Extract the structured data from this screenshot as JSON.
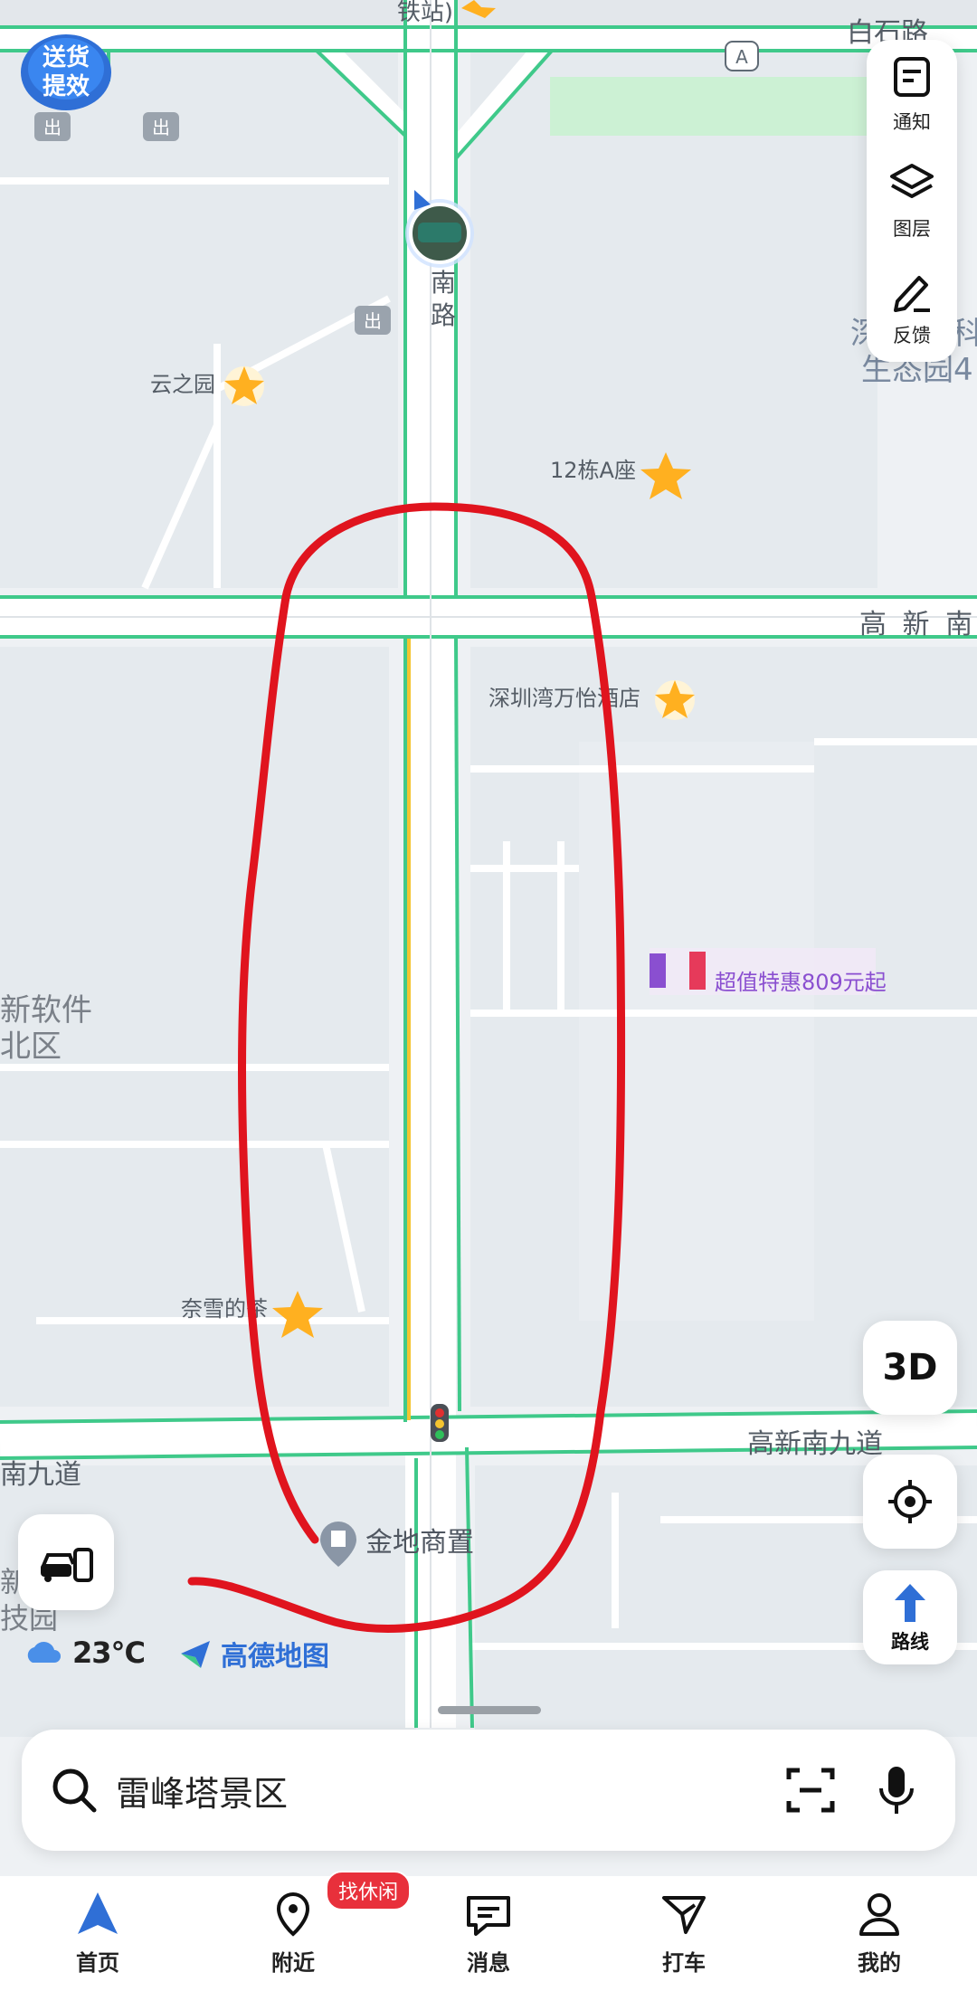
{
  "map": {
    "labels": {
      "station_top": "铁站)",
      "corner_top_right": "白石路",
      "exit_a": "A",
      "exit_1": "出",
      "exit_2": "出",
      "exit_3": "出",
      "road_vertical_1": "南",
      "road_vertical_2": "路",
      "poi_yunzhiyuan": "云之园",
      "poi_12dong": "12栋A座",
      "road_gaoxin_south": "高 新 南 ",
      "poi_hotel": "深圳湾万怡酒店",
      "area_software_1": "新软件",
      "area_software_2": "北区",
      "promo_text": "超值特惠809元起",
      "poi_naixue": "奈雪的茶",
      "road_gaoxin_9_left": "南九道",
      "road_gaoxin_9_right": "高新南九道",
      "poi_jindi": "金地商置",
      "area_left_1": "新",
      "area_left_2": "技园",
      "area_right_1": "深",
      "area_right_2": "科",
      "area_right_3": "生态园4"
    },
    "corner_badge": "送货提效"
  },
  "side_tools": [
    {
      "label": "通知",
      "icon": "notice-icon"
    },
    {
      "label": "图层",
      "icon": "layers-icon"
    },
    {
      "label": "反馈",
      "icon": "feedback-pen-icon"
    }
  ],
  "buttons": {
    "three_d": "3D",
    "route": "路线"
  },
  "weather": {
    "temp": "23°C",
    "icon": "cloud-icon"
  },
  "brand": {
    "name": "高德地图"
  },
  "search": {
    "text": "雷峰塔景区"
  },
  "bottom_nav": [
    {
      "label": "首页",
      "icon": "home-arrow-icon",
      "active": true
    },
    {
      "label": "附近",
      "icon": "nearby-pin-icon",
      "badge": "找休闲"
    },
    {
      "label": "消息",
      "icon": "message-icon"
    },
    {
      "label": "打车",
      "icon": "taxi-icon"
    },
    {
      "label": "我的",
      "icon": "profile-icon"
    }
  ],
  "colors": {
    "road_green": "#3fc98a",
    "road_white": "#ffffff",
    "block": "#e6ebef",
    "park": "#ccf1d4",
    "annotation_red": "#e0141e",
    "accent_blue": "#2f6fd6",
    "star": "#ffb020"
  }
}
